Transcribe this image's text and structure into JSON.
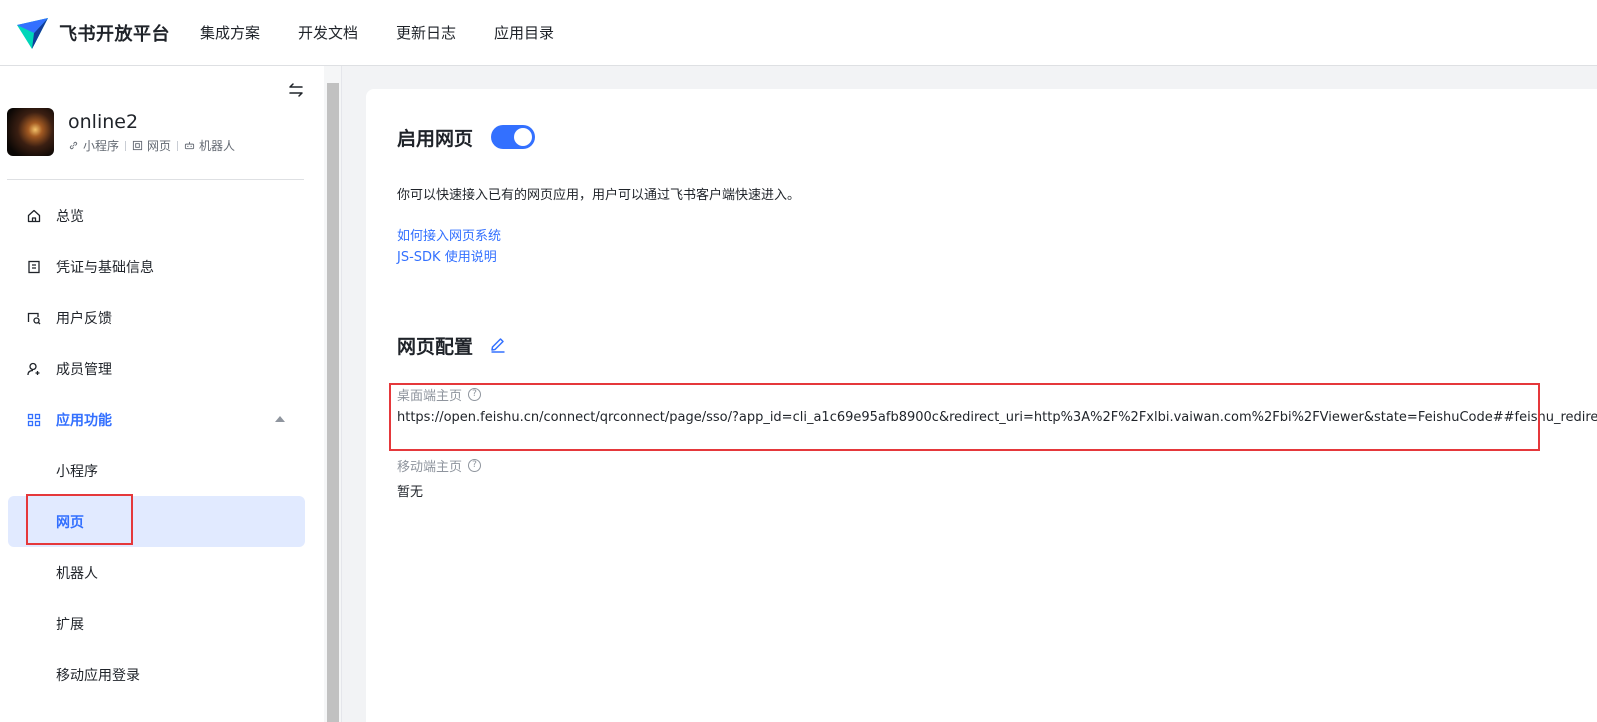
{
  "header": {
    "logo_text": "飞书开放平台",
    "nav": [
      "集成方案",
      "开发文档",
      "更新日志",
      "应用目录"
    ],
    "colors": {
      "brand_blue": "#3370ff",
      "logo_teal": "#00d6b9",
      "logo_navy": "#133c9a"
    }
  },
  "sidebar": {
    "app": {
      "name": "online2",
      "tags": [
        {
          "label": "小程序",
          "icon": "link-icon"
        },
        {
          "label": "网页",
          "icon": "webpage-icon"
        },
        {
          "label": "机器人",
          "icon": "robot-icon"
        }
      ]
    },
    "menu": {
      "overview": "总览",
      "credentials": "凭证与基础信息",
      "feedback": "用户反馈",
      "members": "成员管理",
      "features": "应用功能",
      "mini_program": "小程序",
      "webpage": "网页",
      "bot": "机器人",
      "extension": "扩展",
      "mobile_login": "移动应用登录"
    },
    "active_item": "网页"
  },
  "main": {
    "enable_title": "启用网页",
    "enable_toggle_on": true,
    "description": "你可以快速接入已有的网页应用，用户可以通过飞书客户端快速进入。",
    "links": [
      "如何接入网页系统",
      "JS-SDK 使用说明"
    ],
    "config_title": "网页配置",
    "desktop_label": "桌面端主页",
    "desktop_value": "https://open.feishu.cn/connect/qrconnect/page/sso/?app_id=cli_a1c69e95afb8900c&redirect_uri=http%3A%2F%2Fxlbi.vaiwan.com%2Fbi%2FViewer&state=FeishuCode##feishu_redirect",
    "mobile_label": "移动端主页",
    "mobile_value": "暂无",
    "highlight_color": "#e5383b"
  }
}
